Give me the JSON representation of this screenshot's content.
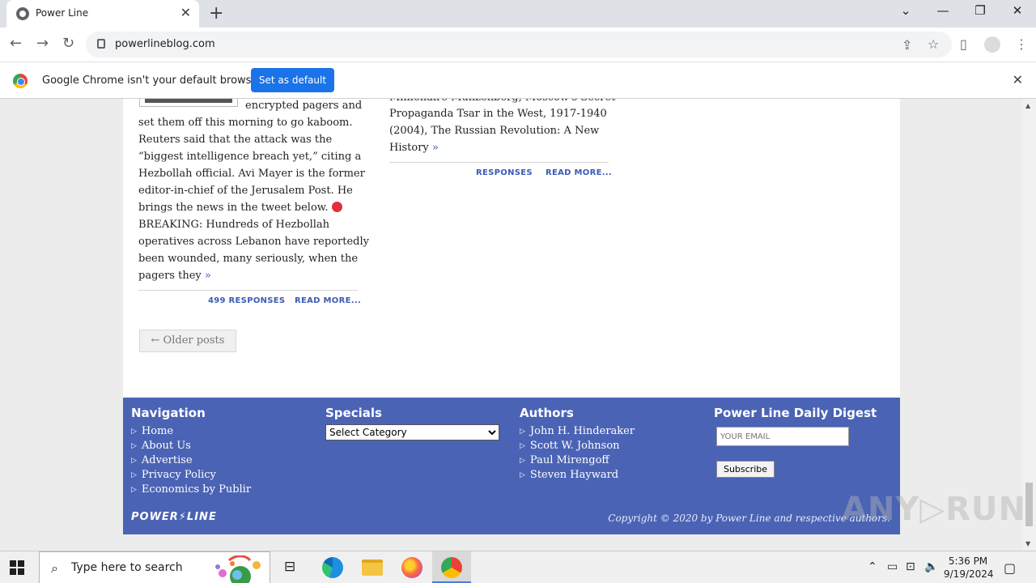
{
  "browser": {
    "tab_title": "Power Line",
    "url": "powerlineblog.com",
    "infobar_message": "Google Chrome isn't your default browser",
    "infobar_button": "Set as default"
  },
  "posts": {
    "left_lines": [
      "encrypted pagers and",
      "set them off this morning to go kaboom.",
      "Reuters said that the attack was the",
      "“biggest intelligence breach yet,” citing a",
      "Hezbollah official. Avi Mayer is the former",
      "editor-in-chief of the Jerusalem Post. He",
      "brings the news in the tweet below.",
      "BREAKING: Hundreds of Hezbollah",
      "operatives across Lebanon have reportedly",
      "been wounded, many seriously, when the",
      "pagers they"
    ],
    "left_more_glyph": "»",
    "left_responses": "499 RESPONSES",
    "left_read_more": "READ MORE...",
    "right_lines": [
      "Millionaire Munzenberg, Moscow's Secret",
      "Propaganda Tsar in the West, 1917-1940",
      "(2004), The Russian Revolution: A New",
      "History"
    ],
    "right_more_glyph": "»",
    "right_responses": "RESPONSES",
    "right_read_more": "READ MORE...",
    "older_posts": "← Older posts"
  },
  "footer": {
    "navigation_heading": "Navigation",
    "navigation_items": [
      "Home",
      "About Us",
      "Advertise",
      "Privacy Policy",
      "Economics by Publir"
    ],
    "specials_heading": "Specials",
    "specials_selected": "Select Category",
    "authors_heading": "Authors",
    "authors_items": [
      "John H. Hinderaker",
      "Scott W. Johnson",
      "Paul Mirengoff",
      "Steven Hayward"
    ],
    "digest_heading": "Power Line Daily Digest",
    "email_placeholder": "YOUR EMAIL",
    "subscribe_label": "Subscribe",
    "logo_text": "POWER⚡LINE",
    "copyright": "Copyright © 2020 by Power Line and respective authors.",
    "bg_color": "#4a63b5"
  },
  "watermark": "ANY▷RUN",
  "taskbar": {
    "search_placeholder": "Type here to search",
    "time": "5:36 PM",
    "date": "9/19/2024"
  },
  "icons": [
    "globe-icon",
    "close-icon",
    "plus-icon",
    "back-icon",
    "forward-icon",
    "reload-icon",
    "lock-icon",
    "share-icon",
    "star-icon",
    "sidepanel-icon",
    "profile-icon",
    "menu-icon",
    "chrome-logo-icon",
    "windows-start-icon",
    "search-icon",
    "taskview-icon",
    "edge-icon",
    "explorer-icon",
    "firefox-icon",
    "chrome-icon",
    "network-icon",
    "volume-icon",
    "notification-icon"
  ]
}
